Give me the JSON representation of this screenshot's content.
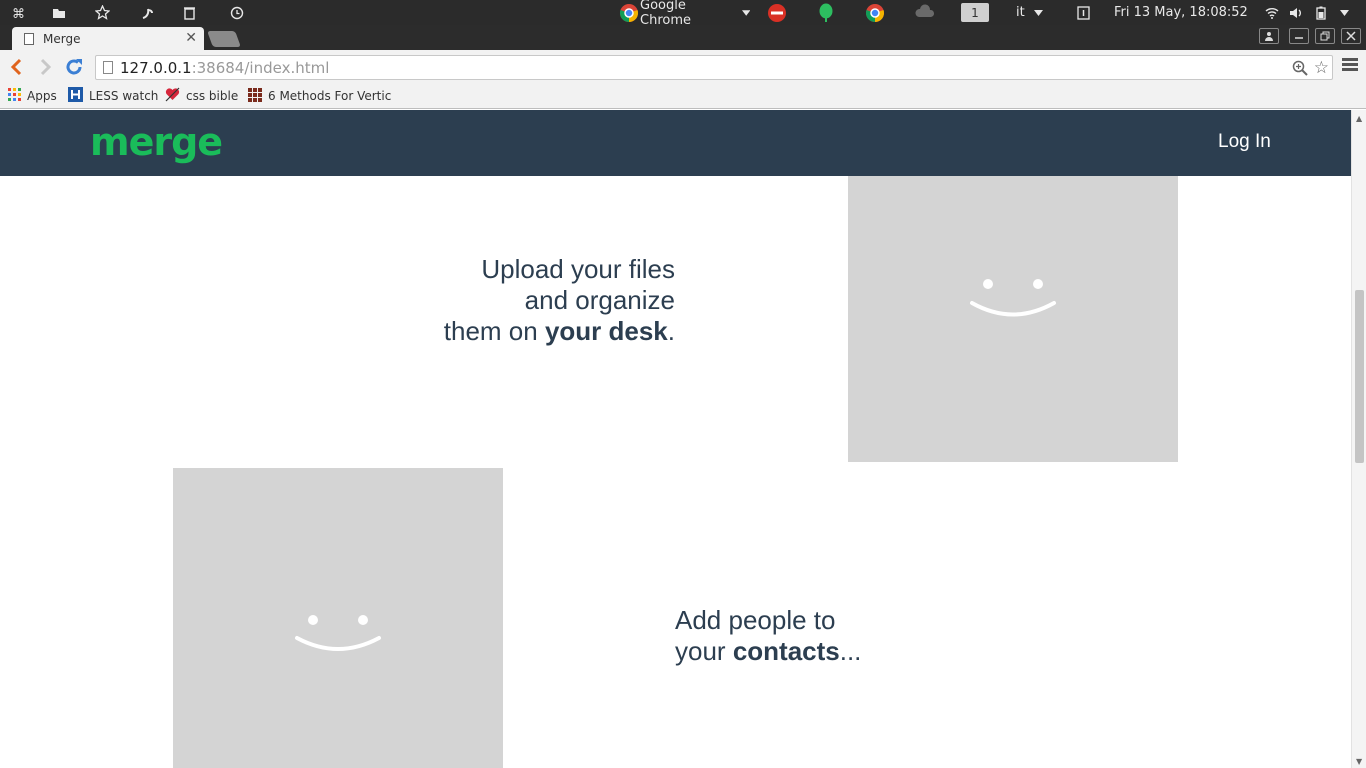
{
  "os_panel": {
    "app_menu_label": "Google Chrome",
    "workspace": "1",
    "language": "it",
    "clock": "Fri 13 May, 18:08:52"
  },
  "browser": {
    "tab_title": "Merge",
    "url_host": "127.0.0.1",
    "url_rest": ":38684/index.html",
    "bookmarks": [
      {
        "label": "Apps",
        "icon": "apps-grid-icon"
      },
      {
        "label": "LESS watch",
        "icon": "h-logo-icon"
      },
      {
        "label": "css bible",
        "icon": "heart-icon"
      },
      {
        "label": "6 Methods For Vertic",
        "icon": "grid-favicon-icon"
      }
    ]
  },
  "site": {
    "logo": "merge",
    "login_label": "Log In",
    "feature1": {
      "line1": "Upload your files",
      "line2": "and organize",
      "line3_prefix": "them on ",
      "line3_bold": "your desk",
      "line3_suffix": "."
    },
    "feature2": {
      "line1": "Add people to",
      "line2_prefix": "your ",
      "line2_bold": "contacts",
      "line2_suffix": "..."
    }
  },
  "colors": {
    "header_bg": "#2c3e50",
    "logo_green": "#1abc5a",
    "placeholder_gray": "#d4d4d4",
    "text_dark": "#2c3e50"
  }
}
